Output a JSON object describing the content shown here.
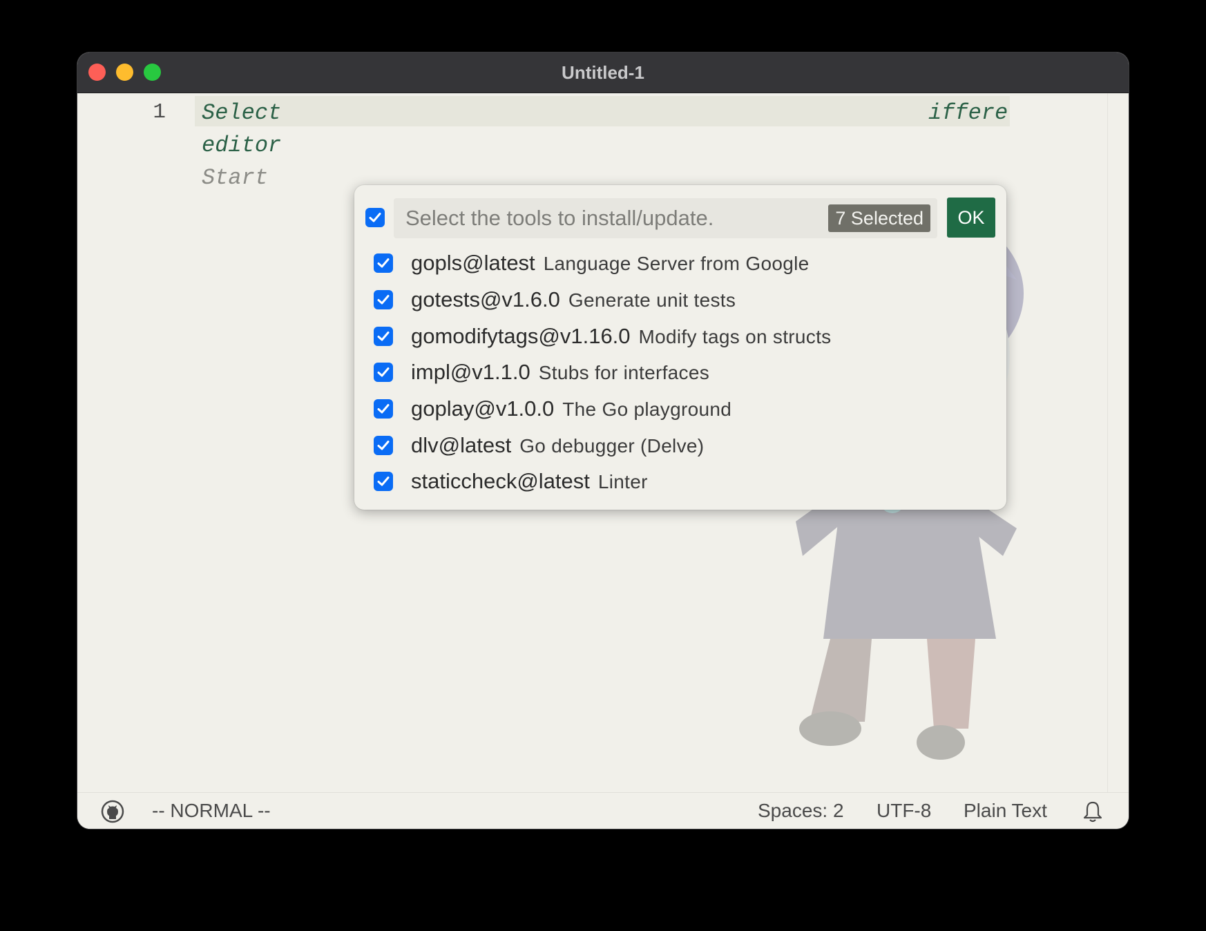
{
  "window": {
    "title": "Untitled-1"
  },
  "editor": {
    "line_number": "1",
    "lines": [
      "Select",
      "editor",
      "Start"
    ],
    "line1_tail": "iffere"
  },
  "picker": {
    "placeholder": "Select the tools to install/update.",
    "selected_count": "7 Selected",
    "ok_label": "OK",
    "select_all_checked": true,
    "items": [
      {
        "name": "gopls@latest",
        "description": "Language Server from Google",
        "checked": true
      },
      {
        "name": "gotests@v1.6.0",
        "description": "Generate unit tests",
        "checked": true
      },
      {
        "name": "gomodifytags@v1.16.0",
        "description": "Modify tags on structs",
        "checked": true
      },
      {
        "name": "impl@v1.1.0",
        "description": "Stubs for interfaces",
        "checked": true
      },
      {
        "name": "goplay@v1.0.0",
        "description": "The Go playground",
        "checked": true
      },
      {
        "name": "dlv@latest",
        "description": "Go debugger (Delve)",
        "checked": true
      },
      {
        "name": "staticcheck@latest",
        "description": "Linter",
        "checked": true
      }
    ]
  },
  "statusbar": {
    "mode": "-- NORMAL --",
    "spaces": "Spaces: 2",
    "encoding": "UTF-8",
    "language": "Plain Text",
    "icons": [
      "github-icon",
      "bell-icon"
    ]
  },
  "colors": {
    "accent_checkbox": "#0a6cf5",
    "ok_button": "#1f6b45",
    "code_green": "#2b6147"
  }
}
